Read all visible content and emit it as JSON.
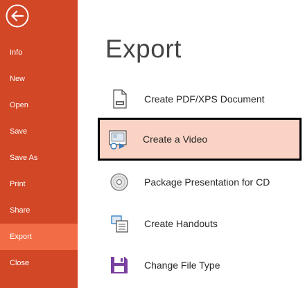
{
  "sidebar": {
    "items": [
      {
        "label": "Info"
      },
      {
        "label": "New"
      },
      {
        "label": "Open"
      },
      {
        "label": "Save"
      },
      {
        "label": "Save As"
      },
      {
        "label": "Print"
      },
      {
        "label": "Share"
      },
      {
        "label": "Export",
        "active": true
      },
      {
        "label": "Close"
      }
    ]
  },
  "main": {
    "title": "Export",
    "options": [
      {
        "label": "Create PDF/XPS Document",
        "icon": "pdf-document-icon"
      },
      {
        "label": "Create a Video",
        "icon": "video-icon",
        "selected": true
      },
      {
        "label": "Package Presentation for CD",
        "icon": "cd-icon"
      },
      {
        "label": "Create Handouts",
        "icon": "handouts-icon"
      },
      {
        "label": "Change File Type",
        "icon": "file-type-icon"
      }
    ]
  },
  "colors": {
    "sidebar": "#d24726",
    "sidebar_active": "#f26d46",
    "selected_option": "#fad3c4"
  }
}
